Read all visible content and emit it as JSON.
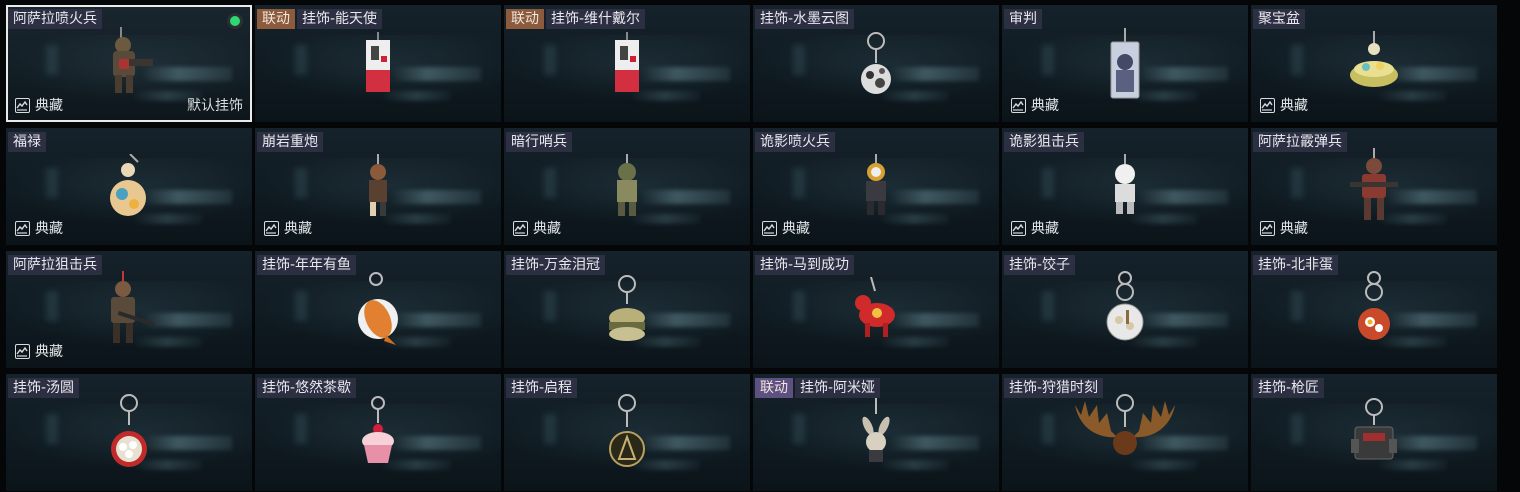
{
  "grid": {
    "cards": [
      {
        "tag": "",
        "title": "阿萨拉喷火兵",
        "collect": "典藏",
        "default": "默认挂饰",
        "selected": true,
        "item": "soldier-flame"
      },
      {
        "tag": "联动",
        "tag_color": "#8c5a3c",
        "title": "挂饰-能天使",
        "collect": "",
        "item": "card-red"
      },
      {
        "tag": "联动",
        "tag_color": "#8c5a3c",
        "title": "挂饰-维什戴尔",
        "collect": "",
        "item": "card-red"
      },
      {
        "tag": "",
        "title": "挂饰-水墨云图",
        "collect": "",
        "item": "ball-ink"
      },
      {
        "tag": "",
        "title": "审判",
        "collect": "典藏",
        "item": "card-portrait"
      },
      {
        "tag": "",
        "title": "聚宝盆",
        "collect": "典藏",
        "item": "bowl-gold"
      },
      {
        "tag": "",
        "title": "福禄",
        "collect": "典藏",
        "item": "gourd"
      },
      {
        "tag": "",
        "title": "崩岩重炮",
        "collect": "典藏",
        "item": "figure-small"
      },
      {
        "tag": "",
        "title": "暗行哨兵",
        "collect": "典藏",
        "item": "figure-camo"
      },
      {
        "tag": "",
        "title": "诡影喷火兵",
        "collect": "典藏",
        "item": "figure-yellow"
      },
      {
        "tag": "",
        "title": "诡影狙击兵",
        "collect": "典藏",
        "item": "figure-white"
      },
      {
        "tag": "",
        "title": "阿萨拉霰弹兵",
        "collect": "典藏",
        "item": "soldier-shotgun"
      },
      {
        "tag": "",
        "title": "阿萨拉狙击兵",
        "collect": "典藏",
        "item": "soldier-sniper"
      },
      {
        "tag": "",
        "title": "挂饰-年年有鱼",
        "collect": "",
        "item": "fish"
      },
      {
        "tag": "",
        "title": "挂饰-万金泪冠",
        "collect": "",
        "item": "burger"
      },
      {
        "tag": "",
        "title": "挂饰-马到成功",
        "collect": "",
        "item": "horse"
      },
      {
        "tag": "",
        "title": "挂饰-饺子",
        "collect": "",
        "item": "plate"
      },
      {
        "tag": "",
        "title": "挂饰-北非蛋",
        "collect": "",
        "item": "pan-egg"
      },
      {
        "tag": "",
        "title": "挂饰-汤圆",
        "collect": "",
        "item": "bowl-balls"
      },
      {
        "tag": "",
        "title": "挂饰-悠然茶歇",
        "collect": "",
        "item": "cupcake"
      },
      {
        "tag": "",
        "title": "挂饰-启程",
        "collect": "",
        "item": "medal"
      },
      {
        "tag": "联动",
        "tag_color": "#5f5082",
        "title": "挂饰-阿米娅",
        "collect": "",
        "item": "bunny"
      },
      {
        "tag": "",
        "title": "挂饰-狩猎时刻",
        "collect": "",
        "item": "antlers"
      },
      {
        "tag": "",
        "title": "挂饰-枪匠",
        "collect": "",
        "item": "toolbox"
      }
    ]
  }
}
